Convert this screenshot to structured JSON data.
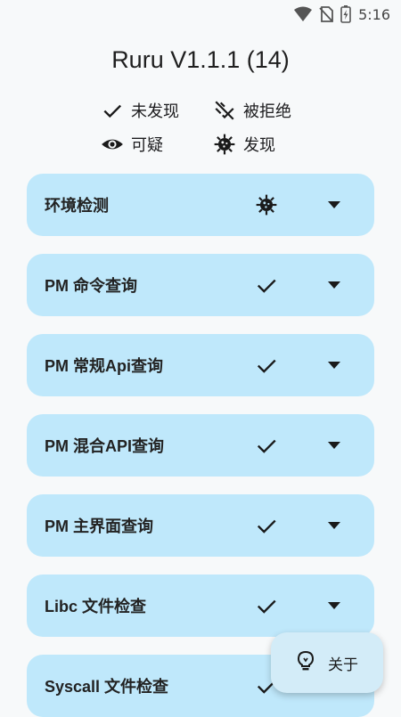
{
  "status_bar": {
    "time": "5:16",
    "icons": [
      "wifi-icon",
      "no-sim-icon",
      "battery-charging-icon"
    ]
  },
  "app": {
    "title": "Ruru V1.1.1 (14)"
  },
  "legend": [
    {
      "icon": "check-icon",
      "label": "未发现"
    },
    {
      "icon": "denied-icon",
      "label": "被拒绝"
    },
    {
      "icon": "eye-icon",
      "label": "可疑"
    },
    {
      "icon": "virus-icon",
      "label": "发现"
    }
  ],
  "checks": [
    {
      "label": "环境检测",
      "status_icon": "virus-icon"
    },
    {
      "label": "PM 命令查询",
      "status_icon": "check-icon"
    },
    {
      "label": "PM 常规Api查询",
      "status_icon": "check-icon"
    },
    {
      "label": "PM 混合API查询",
      "status_icon": "check-icon"
    },
    {
      "label": "PM 主界面查询",
      "status_icon": "check-icon"
    },
    {
      "label": "Libc 文件检查",
      "status_icon": "check-icon"
    },
    {
      "label": "Syscall 文件检查",
      "status_icon": "check-icon"
    }
  ],
  "fab": {
    "label": "关于",
    "icon": "lightbulb-icon"
  },
  "colors": {
    "card_bg": "#bfe8fb",
    "background": "#f7f9fa",
    "fab_bg": "#d3ecf8"
  }
}
